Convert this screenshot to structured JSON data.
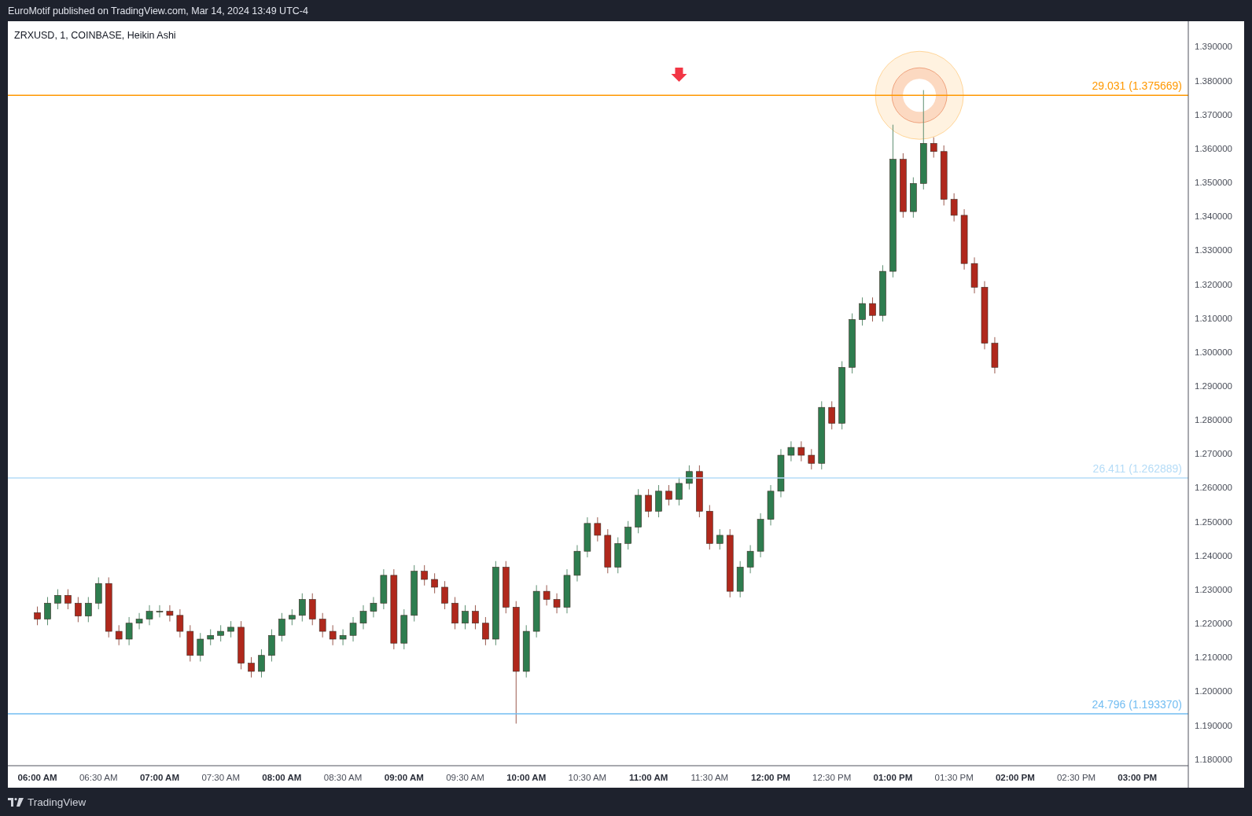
{
  "header": {
    "text": "EuroMotif published on TradingView.com, Mar 14, 2024 13:49 UTC-4"
  },
  "chart": {
    "chart_data": {
      "type": "candlestick",
      "title": "ZRXUSD, 1, COINBASE, Heikin Ashi",
      "xlim": [
        5.7583,
        15.4167
      ],
      "ylim": [
        1.1781,
        1.3975
      ],
      "x": [
        6,
        6.0833,
        6.1667,
        6.25,
        6.3333,
        6.4167,
        6.5,
        6.5833,
        6.6667,
        6.75,
        6.8333,
        6.9167,
        7,
        7.0833,
        7.1667,
        7.25,
        7.3333,
        7.4167,
        7.5,
        7.5833,
        7.6667,
        7.75,
        7.8333,
        7.9167,
        8,
        8.0833,
        8.1667,
        8.25,
        8.3333,
        8.4167,
        8.5,
        8.5833,
        8.6667,
        8.75,
        8.8333,
        8.9167,
        9,
        9.0833,
        9.1667,
        9.25,
        9.3333,
        9.4167,
        9.5,
        9.5833,
        9.6667,
        9.75,
        9.8333,
        9.9167,
        10,
        10.0833,
        10.1667,
        10.25,
        10.3333,
        10.4167,
        10.5,
        10.5833,
        10.6667,
        10.75,
        10.8333,
        10.9167,
        11,
        11.0833,
        11.1667,
        11.25,
        11.3333,
        11.4167,
        11.5,
        11.5833,
        11.6667,
        11.75,
        11.8333,
        11.9167,
        12,
        12.0833,
        12.1667,
        12.25,
        12.3333,
        12.4167,
        12.5,
        12.5833,
        12.6667,
        12.75,
        12.8333,
        12.9167,
        13,
        13.0833,
        13.1667,
        13.25,
        13.3333,
        13.4167,
        13.5,
        13.5833,
        13.6667,
        13.75,
        13.8333
      ],
      "ohlc": [
        [
          1.2232,
          1.225,
          1.2195,
          1.2213
        ],
        [
          1.2213,
          1.2278,
          1.2195,
          1.226
        ],
        [
          1.226,
          1.2301,
          1.2242,
          1.2283
        ],
        [
          1.2283,
          1.2301,
          1.2242,
          1.226
        ],
        [
          1.226,
          1.2278,
          1.2204,
          1.2222
        ],
        [
          1.2222,
          1.2278,
          1.2204,
          1.226
        ],
        [
          1.226,
          1.2336,
          1.2242,
          1.2318
        ],
        [
          1.2318,
          1.2336,
          1.2159,
          1.2177
        ],
        [
          1.2177,
          1.2195,
          1.2136,
          1.2154
        ],
        [
          1.2154,
          1.2219,
          1.2136,
          1.2201
        ],
        [
          1.2201,
          1.2231,
          1.2183,
          1.2213
        ],
        [
          1.2213,
          1.2254,
          1.2195,
          1.2236
        ],
        [
          1.2236,
          1.2254,
          1.2218,
          1.2236
        ],
        [
          1.2236,
          1.2254,
          1.2206,
          1.2224
        ],
        [
          1.2224,
          1.2242,
          1.2159,
          1.2177
        ],
        [
          1.2177,
          1.2195,
          1.2088,
          1.2106
        ],
        [
          1.2106,
          1.2172,
          1.2088,
          1.2154
        ],
        [
          1.2154,
          1.2183,
          1.2136,
          1.2165
        ],
        [
          1.2165,
          1.2195,
          1.2147,
          1.2177
        ],
        [
          1.2177,
          1.2207,
          1.2159,
          1.2189
        ],
        [
          1.2189,
          1.2207,
          1.2065,
          1.2083
        ],
        [
          1.2083,
          1.2101,
          1.2041,
          1.2059
        ],
        [
          1.2059,
          1.2124,
          1.2041,
          1.2106
        ],
        [
          1.2106,
          1.2183,
          1.2088,
          1.2165
        ],
        [
          1.2165,
          1.2231,
          1.2147,
          1.2213
        ],
        [
          1.2213,
          1.2242,
          1.2195,
          1.2224
        ],
        [
          1.2224,
          1.2289,
          1.2206,
          1.2271
        ],
        [
          1.2271,
          1.2289,
          1.2195,
          1.2213
        ],
        [
          1.2213,
          1.2231,
          1.2159,
          1.2177
        ],
        [
          1.2177,
          1.2195,
          1.2136,
          1.2154
        ],
        [
          1.2154,
          1.2183,
          1.2136,
          1.2165
        ],
        [
          1.2165,
          1.2219,
          1.2147,
          1.2201
        ],
        [
          1.2201,
          1.2254,
          1.2183,
          1.2236
        ],
        [
          1.2236,
          1.2278,
          1.2218,
          1.226
        ],
        [
          1.226,
          1.236,
          1.2242,
          1.2342
        ],
        [
          1.2342,
          1.236,
          1.2124,
          1.2142
        ],
        [
          1.2142,
          1.2242,
          1.2124,
          1.2224
        ],
        [
          1.2224,
          1.2372,
          1.2206,
          1.2354
        ],
        [
          1.2354,
          1.2372,
          1.2312,
          1.233
        ],
        [
          1.233,
          1.2348,
          1.2289,
          1.2307
        ],
        [
          1.2307,
          1.2325,
          1.2242,
          1.226
        ],
        [
          1.226,
          1.2278,
          1.2183,
          1.2201
        ],
        [
          1.2201,
          1.2254,
          1.2183,
          1.2236
        ],
        [
          1.2236,
          1.2254,
          1.2183,
          1.2201
        ],
        [
          1.2201,
          1.2219,
          1.2136,
          1.2154
        ],
        [
          1.2154,
          1.2384,
          1.2136,
          1.2366
        ],
        [
          1.2366,
          1.2384,
          1.223,
          1.2248
        ],
        [
          1.2248,
          1.2266,
          1.1905,
          1.2059
        ],
        [
          1.2059,
          1.2195,
          1.2041,
          1.2177
        ],
        [
          1.2177,
          1.2313,
          1.2159,
          1.2295
        ],
        [
          1.2295,
          1.2313,
          1.2253,
          1.2271
        ],
        [
          1.2271,
          1.2289,
          1.223,
          1.2248
        ],
        [
          1.2248,
          1.236,
          1.223,
          1.2342
        ],
        [
          1.2342,
          1.2431,
          1.2324,
          1.2413
        ],
        [
          1.2413,
          1.2513,
          1.2395,
          1.2495
        ],
        [
          1.2495,
          1.2513,
          1.2442,
          1.246
        ],
        [
          1.246,
          1.2478,
          1.2348,
          1.2366
        ],
        [
          1.2366,
          1.2454,
          1.2348,
          1.2436
        ],
        [
          1.2436,
          1.2502,
          1.2418,
          1.2484
        ],
        [
          1.2484,
          1.2596,
          1.2466,
          1.2578
        ],
        [
          1.2578,
          1.2596,
          1.2513,
          1.2531
        ],
        [
          1.2531,
          1.2608,
          1.2513,
          1.259
        ],
        [
          1.259,
          1.2608,
          1.2548,
          1.2566
        ],
        [
          1.2566,
          1.2631,
          1.2548,
          1.2613
        ],
        [
          1.2613,
          1.2666,
          1.2595,
          1.2648
        ],
        [
          1.2648,
          1.2666,
          1.2513,
          1.2531
        ],
        [
          1.2531,
          1.2549,
          1.2418,
          1.2436
        ],
        [
          1.2436,
          1.2478,
          1.2418,
          1.246
        ],
        [
          1.246,
          1.2478,
          1.2277,
          1.2295
        ],
        [
          1.2295,
          1.2384,
          1.2277,
          1.2366
        ],
        [
          1.2366,
          1.2431,
          1.2348,
          1.2413
        ],
        [
          1.2413,
          1.2525,
          1.2395,
          1.2507
        ],
        [
          1.2507,
          1.2608,
          1.2489,
          1.259
        ],
        [
          1.259,
          1.2714,
          1.2572,
          1.2696
        ],
        [
          1.2696,
          1.2737,
          1.2678,
          1.2719
        ],
        [
          1.2719,
          1.2737,
          1.2678,
          1.2696
        ],
        [
          1.2696,
          1.2714,
          1.2654,
          1.2672
        ],
        [
          1.2672,
          1.2855,
          1.2654,
          1.2837
        ],
        [
          1.2837,
          1.2855,
          1.2772,
          1.279
        ],
        [
          1.279,
          1.2973,
          1.2772,
          1.2955
        ],
        [
          1.2955,
          1.3114,
          1.2937,
          1.3096
        ],
        [
          1.3096,
          1.3161,
          1.3078,
          1.3143
        ],
        [
          1.3143,
          1.3161,
          1.309,
          1.3108
        ],
        [
          1.3108,
          1.3256,
          1.309,
          1.3238
        ],
        [
          1.3238,
          1.367,
          1.322,
          1.3568
        ],
        [
          1.3568,
          1.3586,
          1.3396,
          1.3414
        ],
        [
          1.3414,
          1.3515,
          1.3396,
          1.3497
        ],
        [
          1.3497,
          1.3772,
          1.3479,
          1.3615
        ],
        [
          1.3615,
          1.3633,
          1.3573,
          1.3591
        ],
        [
          1.3591,
          1.3609,
          1.3432,
          1.345
        ],
        [
          1.345,
          1.3468,
          1.3385,
          1.3403
        ],
        [
          1.3403,
          1.3421,
          1.3243,
          1.3261
        ],
        [
          1.3261,
          1.3279,
          1.3173,
          1.3191
        ],
        [
          1.3191,
          1.3209,
          1.3008,
          1.3026
        ],
        [
          1.3026,
          1.3044,
          1.2937,
          1.2955
        ]
      ],
      "xticks": [
        {
          "value": 6,
          "label": "06:00 AM"
        },
        {
          "value": 6.5,
          "label": "06:30 AM"
        },
        {
          "value": 7,
          "label": "07:00 AM"
        },
        {
          "value": 7.5,
          "label": "07:30 AM"
        },
        {
          "value": 8,
          "label": "08:00 AM"
        },
        {
          "value": 8.5,
          "label": "08:30 AM"
        },
        {
          "value": 9,
          "label": "09:00 AM"
        },
        {
          "value": 9.5,
          "label": "09:30 AM"
        },
        {
          "value": 10,
          "label": "10:00 AM"
        },
        {
          "value": 10.5,
          "label": "10:30 AM"
        },
        {
          "value": 11,
          "label": "11:00 AM"
        },
        {
          "value": 11.5,
          "label": "11:30 AM"
        },
        {
          "value": 12,
          "label": "12:00 PM"
        },
        {
          "value": 12.5,
          "label": "12:30 PM"
        },
        {
          "value": 13,
          "label": "01:00 PM"
        },
        {
          "value": 13.5,
          "label": "01:30 PM"
        },
        {
          "value": 14,
          "label": "02:00 PM"
        },
        {
          "value": 14.5,
          "label": "02:30 PM"
        },
        {
          "value": 15,
          "label": "03:00 PM"
        }
      ],
      "yticks": [
        {
          "value": 1.39,
          "label": "1.390000"
        },
        {
          "value": 1.38,
          "label": "1.380000"
        },
        {
          "value": 1.37,
          "label": "1.370000"
        },
        {
          "value": 1.36,
          "label": "1.360000"
        },
        {
          "value": 1.35,
          "label": "1.350000"
        },
        {
          "value": 1.34,
          "label": "1.340000"
        },
        {
          "value": 1.33,
          "label": "1.330000"
        },
        {
          "value": 1.32,
          "label": "1.320000"
        },
        {
          "value": 1.31,
          "label": "1.310000"
        },
        {
          "value": 1.3,
          "label": "1.300000"
        },
        {
          "value": 1.29,
          "label": "1.290000"
        },
        {
          "value": 1.28,
          "label": "1.280000"
        },
        {
          "value": 1.27,
          "label": "1.270000"
        },
        {
          "value": 1.26,
          "label": "1.260000"
        },
        {
          "value": 1.25,
          "label": "1.250000"
        },
        {
          "value": 1.24,
          "label": "1.240000"
        },
        {
          "value": 1.23,
          "label": "1.230000"
        },
        {
          "value": 1.22,
          "label": "1.220000"
        },
        {
          "value": 1.21,
          "label": "1.210000"
        },
        {
          "value": 1.2,
          "label": "1.200000"
        },
        {
          "value": 1.19,
          "label": "1.190000"
        },
        {
          "value": 1.18,
          "label": "1.180000"
        }
      ],
      "ref_lines": [
        {
          "axis": "y",
          "value": 1.375669,
          "label": "29.031 (1.375669)",
          "color": "#ff9800"
        },
        {
          "axis": "y",
          "value": 1.262889,
          "label": "26.411 (1.262889)",
          "color": "#b5dcf7"
        },
        {
          "axis": "y",
          "value": 1.19337,
          "label": "24.796 (1.193370)",
          "color": "#72bdf2"
        }
      ]
    }
  },
  "footer": {
    "brand": "TradingView"
  }
}
